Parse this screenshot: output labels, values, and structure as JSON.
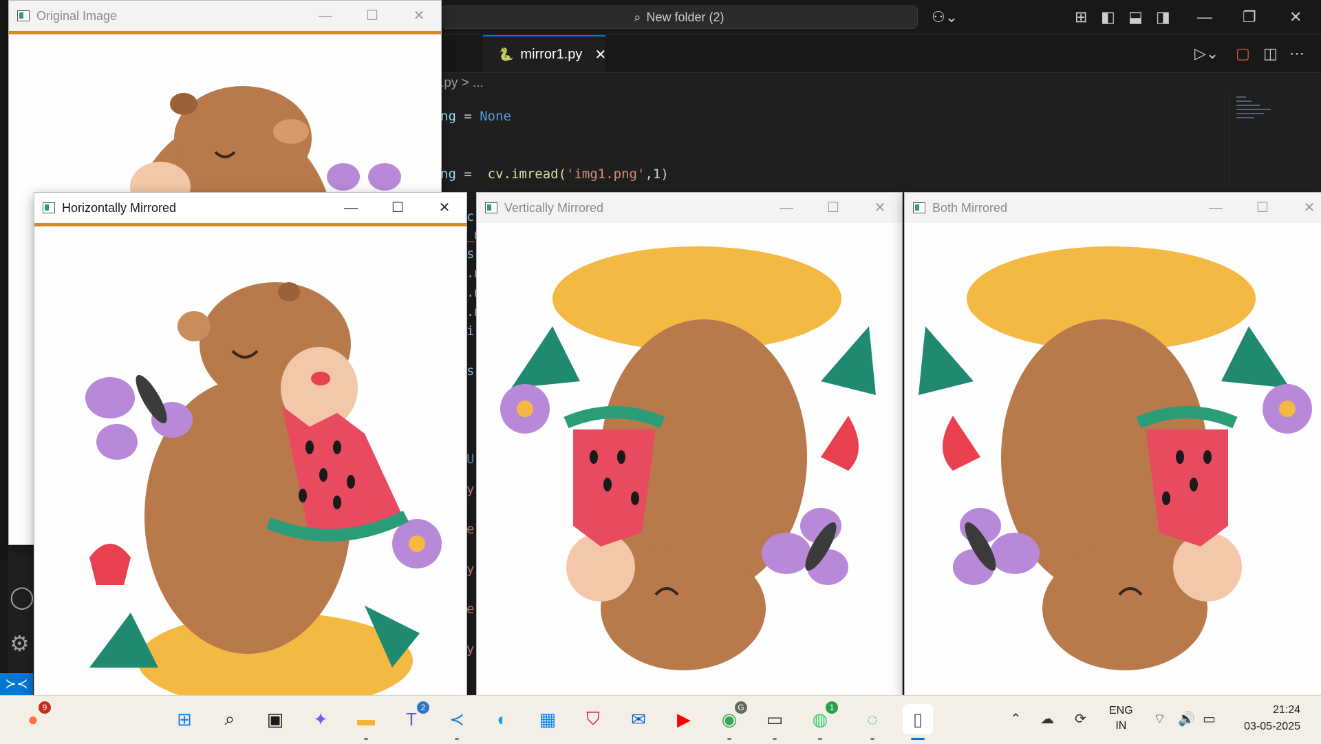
{
  "vscode": {
    "search_text": "New folder (2)",
    "tab_label": "mirror1.py",
    "breadcrumb": ".py > ...",
    "code_lines": [
      {
        "a": "ng",
        "b": " = ",
        "c": "None"
      },
      {
        "a": "ng",
        "b": " =  ",
        "c": "cv.imread(",
        "d": "'img1.png'",
        "e": ",1)"
      }
    ],
    "code_fragments": [
      "c",
      "_m",
      "s",
      ".m",
      ".m",
      ".m",
      "i",
      "s",
      "U",
      "y",
      "e",
      "y",
      "e",
      "y"
    ]
  },
  "windows": {
    "original": {
      "title": "Original Image"
    },
    "horizontal": {
      "title": "Horizontally Mirrored"
    },
    "vertical": {
      "title": "Vertically Mirrored"
    },
    "both": {
      "title": "Both Mirrored"
    }
  },
  "window_controls": {
    "minimize": "—",
    "maximize": "☐",
    "close": "✕"
  },
  "taskbar": {
    "apps": [
      {
        "name": "firefox",
        "badge": "9"
      },
      {
        "name": "start"
      },
      {
        "name": "search"
      },
      {
        "name": "task-view"
      },
      {
        "name": "copilot"
      },
      {
        "name": "file-explorer"
      },
      {
        "name": "teams",
        "badge": "2"
      },
      {
        "name": "vscode"
      },
      {
        "name": "edge"
      },
      {
        "name": "store"
      },
      {
        "name": "mcafee"
      },
      {
        "name": "outlook"
      },
      {
        "name": "youtube"
      },
      {
        "name": "chrome",
        "badge": "G"
      },
      {
        "name": "terminal"
      },
      {
        "name": "whatsapp",
        "badge": "1"
      },
      {
        "name": "loop"
      },
      {
        "name": "file"
      }
    ],
    "lang_top": "ENG",
    "lang_bottom": "IN",
    "time": "21:24",
    "date": "03-05-2025"
  },
  "colors": {
    "accent": "#0078d4",
    "capybara": "#b87a4b",
    "watermelon": "#e84a5f",
    "rind": "#2a9d78",
    "sand": "#f4b942",
    "butterfly": "#b889d8",
    "flower_red": "#e8404f",
    "leaf": "#1f8a70"
  }
}
